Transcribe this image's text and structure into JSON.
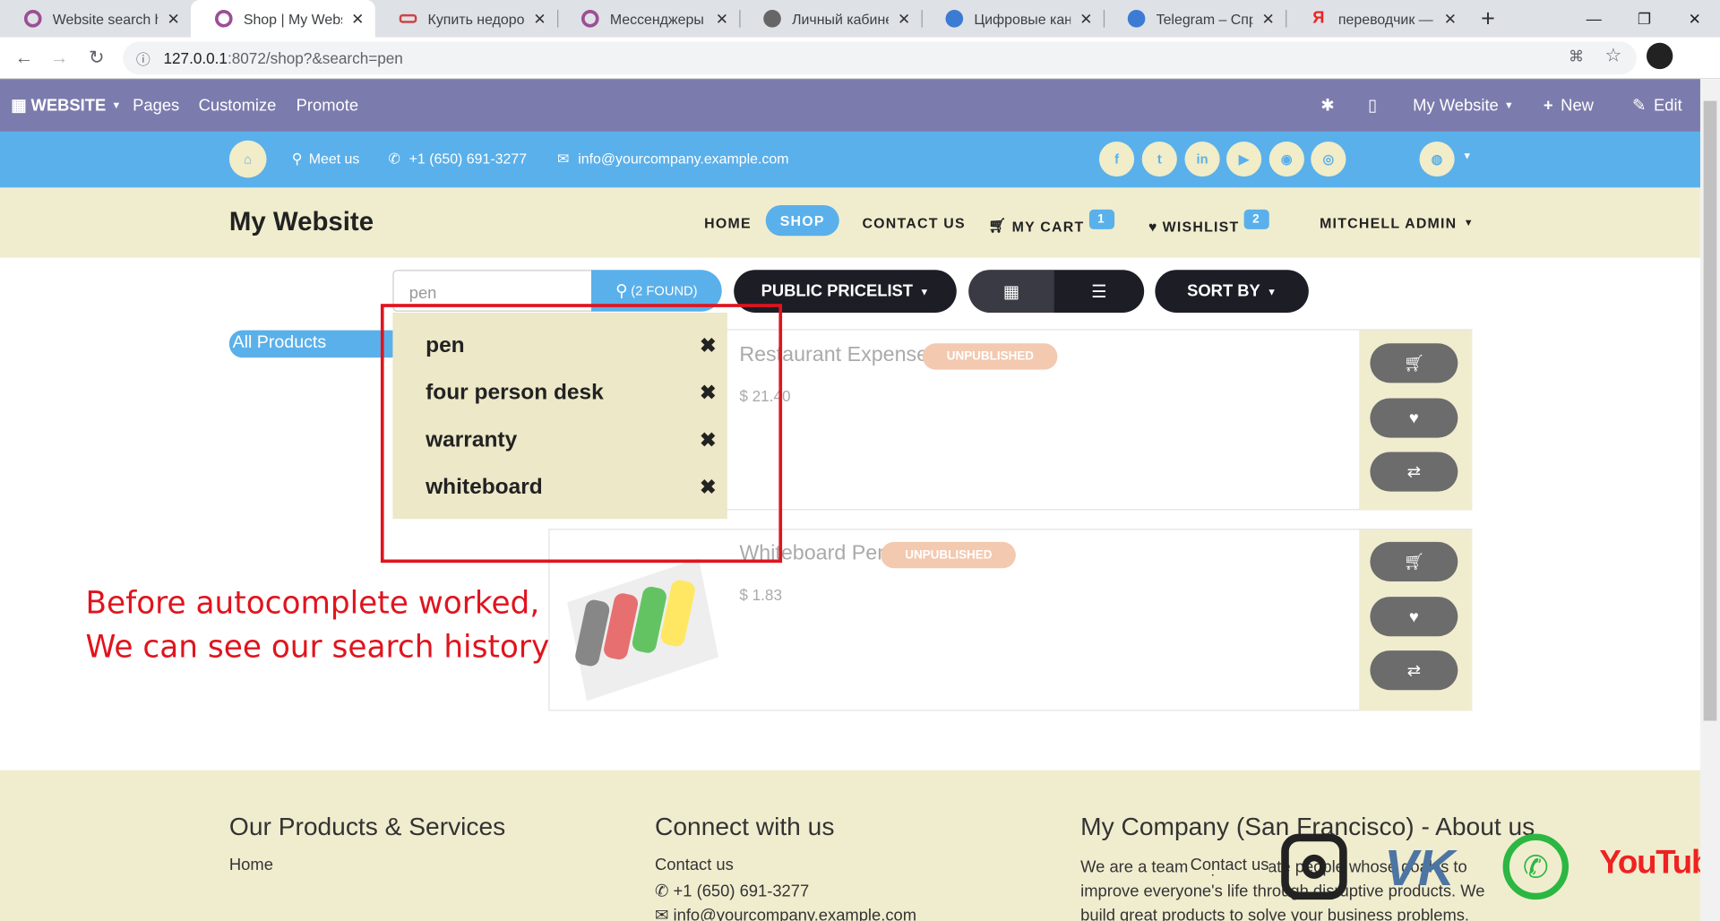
{
  "browser": {
    "tabs": [
      {
        "title": "Website search his",
        "icon_color": "#9b4f96"
      },
      {
        "title": "Shop | My Website",
        "icon_color": "#9b4f96"
      },
      {
        "title": "Купить недорогие",
        "icon_color": "#c44"
      },
      {
        "title": "Мессенджеры на",
        "icon_color": "#9b4f96"
      },
      {
        "title": "Личный кабинет",
        "icon_color": "#555"
      },
      {
        "title": "Цифровые каналы",
        "icon_color": "#3b7bd4"
      },
      {
        "title": "Telegram – Справо",
        "icon_color": "#3b7bd4"
      },
      {
        "title": "переводчик — Ян",
        "icon_color": "#e22"
      }
    ],
    "new_tab": "+",
    "url_host": "127.0.0.1",
    "url_rest": ":8072/shop?&search=pen"
  },
  "odoo_bar": {
    "website": "WEBSITE",
    "pages": "Pages",
    "customize": "Customize",
    "promote": "Promote",
    "my_website": "My Website",
    "new": "New",
    "edit": "Edit"
  },
  "topbar": {
    "meet": "Meet us",
    "phone": "+1 (650) 691-3277",
    "email": "info@yourcompany.example.com"
  },
  "header": {
    "brand": "My Website",
    "home": "HOME",
    "shop": "SHOP",
    "contact": "CONTACT US",
    "cart": "MY CART",
    "cart_count": "1",
    "wishlist": "WISHLIST",
    "wishlist_count": "2",
    "user": "MITCHELL ADMIN"
  },
  "search": {
    "value": "pen",
    "found": "(2 FOUND)"
  },
  "toolbar": {
    "pricelist": "PUBLIC PRICELIST",
    "sort": "SORT BY"
  },
  "sidebar": {
    "all_products": "All Products"
  },
  "history": [
    "pen",
    "four person desk",
    "warranty",
    "whiteboard"
  ],
  "products": [
    {
      "name": "Restaurant Expenses",
      "status": "UNPUBLISHED",
      "price": "$ 21.40"
    },
    {
      "name": "Whiteboard Pen",
      "status": "UNPUBLISHED",
      "price": "$ 1.83"
    }
  ],
  "annotation": {
    "line1": "Before autocomplete worked,",
    "line2": "We can see our  search history",
    "color": "#e0141e"
  },
  "footer": {
    "col1_title": "Our Products & Services",
    "col1_link": "Home",
    "col2_title": "Connect with us",
    "col2_contact": "Contact us",
    "col2_phone": "+1 (650) 691-3277",
    "col2_email": "info@yourcompany.example.com",
    "col3_title": "My Company (San Francisco) - About us",
    "col3_text1": "We are a team of passionate people whose goal is to",
    "col3_text2": "improve everyone's life through disruptive products. We",
    "col3_text3": "build great products to solve your business problems.",
    "overlay_text": "Contact us",
    "youtube": "YouTube"
  }
}
